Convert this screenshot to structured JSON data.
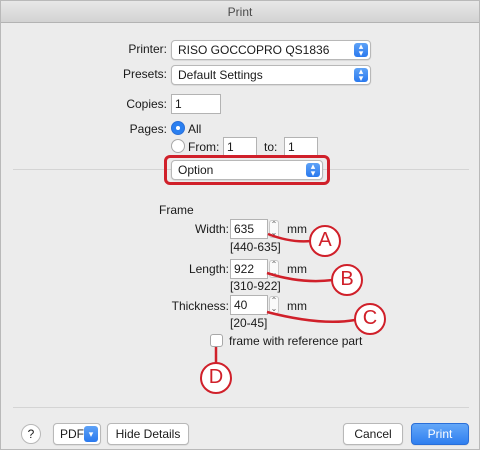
{
  "window": {
    "title": "Print"
  },
  "printer": {
    "label": "Printer:",
    "value": "RISO GOCCOPRO QS1836"
  },
  "presets": {
    "label": "Presets:",
    "value": "Default Settings"
  },
  "copies": {
    "label": "Copies:",
    "value": "1"
  },
  "pages": {
    "label": "Pages:",
    "all_label": "All",
    "from_label": "From:",
    "from_value": "1",
    "to_label": "to:",
    "to_value": "1",
    "selected": "All"
  },
  "section_popup": {
    "value": "Option"
  },
  "frame": {
    "heading": "Frame",
    "width": {
      "label": "Width:",
      "value": "635",
      "unit": "mm",
      "range": "[440-635]"
    },
    "length": {
      "label": "Length:",
      "value": "922",
      "unit": "mm",
      "range": "[310-922]"
    },
    "thickness": {
      "label": "Thickness:",
      "value": "40",
      "unit": "mm",
      "range": "[20-45]"
    },
    "reference_checkbox": {
      "label": "frame with reference part",
      "checked": false
    }
  },
  "callouts": [
    "A",
    "B",
    "C",
    "D"
  ],
  "footer": {
    "help": "?",
    "pdf": "PDF",
    "hide_details": "Hide Details",
    "cancel": "Cancel",
    "print": "Print"
  },
  "colors": {
    "accent": "#2a7ff0",
    "callout": "#d0202a",
    "window_bg": "#ececec"
  }
}
